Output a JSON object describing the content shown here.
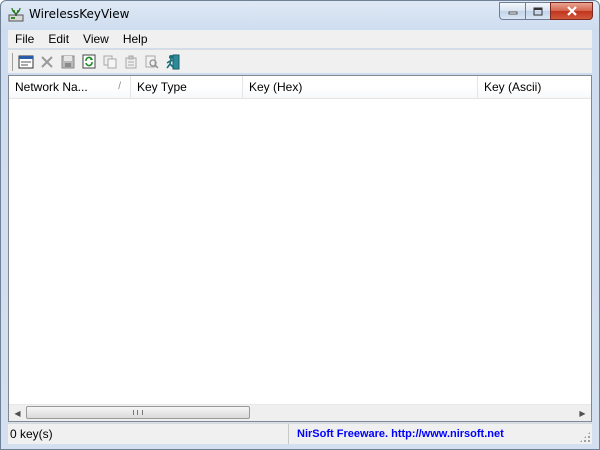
{
  "window": {
    "title": "WirelessKeyView",
    "controls": {
      "minimize_icon": "minimize-icon",
      "maximize_icon": "maximize-icon",
      "close_icon": "close-icon"
    }
  },
  "menu": {
    "items": [
      {
        "label": "File"
      },
      {
        "label": "Edit"
      },
      {
        "label": "View"
      },
      {
        "label": "Help"
      }
    ]
  },
  "toolbar": {
    "buttons": [
      {
        "icon": "html-report-icon"
      },
      {
        "icon": "delete-icon"
      },
      {
        "icon": "save-icon"
      },
      {
        "icon": "refresh-icon"
      },
      {
        "icon": "copy-icon"
      },
      {
        "icon": "properties-icon"
      },
      {
        "icon": "find-icon"
      },
      {
        "icon": "exit-icon"
      }
    ]
  },
  "list": {
    "columns": [
      {
        "label": "Network Na..."
      },
      {
        "label": "Key Type"
      },
      {
        "label": "Key (Hex)"
      },
      {
        "label": "Key (Ascii)"
      }
    ],
    "sort_indicator": "/",
    "rows": []
  },
  "status": {
    "count": "0 key(s)",
    "credit": "NirSoft Freeware.  http://www.nirsoft.net"
  },
  "colors": {
    "credit_text": "#0000ff",
    "close_button": "#c7422a",
    "titlebar": "#d4e0ef"
  }
}
